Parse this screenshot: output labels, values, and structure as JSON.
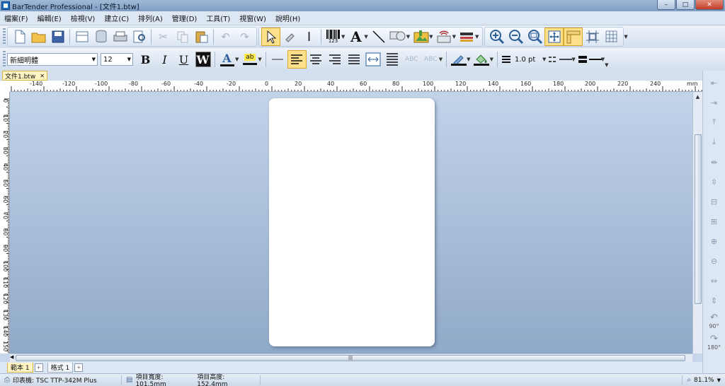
{
  "window": {
    "title": "BarTender Professional - [文件1.btw]",
    "minimize": "–",
    "maximize": "□",
    "close": "✕"
  },
  "menu": [
    "檔案(F)",
    "編輯(E)",
    "檢視(V)",
    "建立(C)",
    "排列(A)",
    "管理(D)",
    "工具(T)",
    "視窗(W)",
    "說明(H)"
  ],
  "toolbar": {
    "font_name": "新細明體",
    "font_size": "12",
    "bold": "B",
    "italic": "I",
    "underline": "U",
    "reverse": "W",
    "text_color_glyph": "A",
    "highlight_glyph": "ab",
    "barcode_caption": "123",
    "text_tool_glyph": "A",
    "line_width": "1.0 pt",
    "abc1": "ABC",
    "abc2": "ABC"
  },
  "document_tab": {
    "name": "文件1.btw",
    "close": "✕"
  },
  "ruler": {
    "unit": "mm",
    "h_ticks": [
      "-140",
      "-120",
      "-100",
      "-80",
      "-60",
      "-40",
      "-20",
      "0",
      "20",
      "40",
      "60",
      "80",
      "100",
      "120",
      "140",
      "160",
      "180",
      "200",
      "220",
      "240"
    ],
    "v_ticks": [
      "0",
      "10",
      "20",
      "30",
      "40",
      "50",
      "60",
      "70",
      "80",
      "90",
      "100",
      "110",
      "120",
      "130",
      "140",
      "150"
    ]
  },
  "right_panel": {
    "rotate_left": "90°",
    "rotate_right": "180°"
  },
  "page_tabs": [
    {
      "label": "範本 1",
      "active": true
    },
    {
      "label": "格式 1",
      "active": false
    }
  ],
  "status": {
    "printer": "印表機: TSC TTP-342M Plus",
    "width": "項目寬度: 101.5mm",
    "height": "項目高度: 152.4mm",
    "zoom": "81.1%"
  },
  "colors": {
    "active_button": "#ffe08a",
    "canvas_top": "#c3d4ea",
    "canvas_bottom": "#8fa9c8"
  }
}
